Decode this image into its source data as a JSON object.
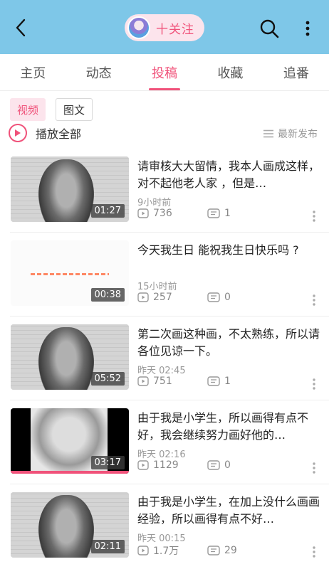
{
  "header": {
    "follow_label": "十关注",
    "icons": [
      "back-icon",
      "search-icon",
      "more-vertical-icon"
    ],
    "background": "#7ec7e8",
    "accent": "#f0527a"
  },
  "tabs": [
    {
      "label": "主页",
      "active": false
    },
    {
      "label": "动态",
      "active": false
    },
    {
      "label": "投稿",
      "active": true
    },
    {
      "label": "收藏",
      "active": false
    },
    {
      "label": "追番",
      "active": false
    }
  ],
  "filters": {
    "video": "视频",
    "article": "图文"
  },
  "toolbar": {
    "play_all": "播放全部",
    "sort": "最新发布"
  },
  "videos": [
    {
      "title": "请审核大大留情，我本人画成这样，对不起他老人家 ，但是…",
      "time": "9小时前",
      "duration": "01:27",
      "views": "736",
      "comments": "1"
    },
    {
      "title": "今天我生日 能祝我生日快乐吗 ?",
      "time": "15小时前",
      "duration": "00:38",
      "views": "257",
      "comments": "0"
    },
    {
      "title": "第二次画这种画，不太熟练，所以请各位见谅一下。",
      "time": "昨天 02:45",
      "duration": "05:52",
      "views": "751",
      "comments": "1"
    },
    {
      "title": "由于我是小学生，所以画得有点不好，我会继续努力画好他的…",
      "time": "昨天 02:16",
      "duration": "03:17",
      "views": "1129",
      "comments": "0"
    },
    {
      "title": "由于我是小学生，在加上没什么画画经验，所以画得有点不好…",
      "time": "昨天 00:15",
      "duration": "02:11",
      "views": "1.7万",
      "comments": "29"
    }
  ]
}
